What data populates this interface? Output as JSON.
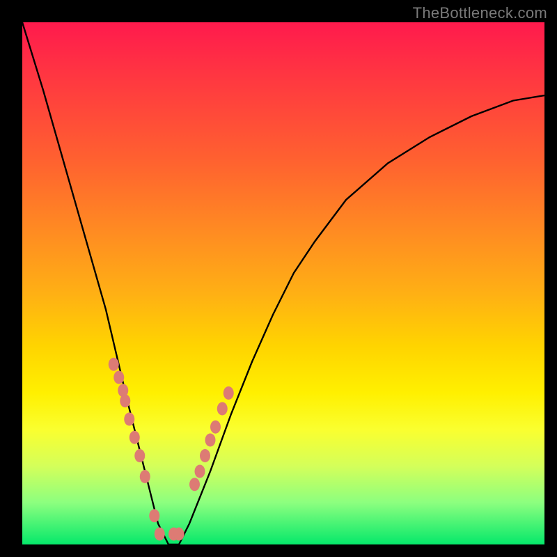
{
  "watermark": "TheBottleneck.com",
  "chart_data": {
    "type": "line",
    "title": "",
    "xlabel": "",
    "ylabel": "",
    "xlim": [
      0,
      1
    ],
    "ylim": [
      0,
      1
    ],
    "series": [
      {
        "name": "bottleneck-curve",
        "x": [
          0.0,
          0.04,
          0.08,
          0.12,
          0.16,
          0.2,
          0.22,
          0.24,
          0.26,
          0.28,
          0.3,
          0.32,
          0.36,
          0.4,
          0.44,
          0.48,
          0.52,
          0.56,
          0.62,
          0.7,
          0.78,
          0.86,
          0.94,
          1.0
        ],
        "values": [
          1.0,
          0.87,
          0.73,
          0.59,
          0.45,
          0.28,
          0.2,
          0.12,
          0.04,
          0.0,
          0.0,
          0.04,
          0.14,
          0.25,
          0.35,
          0.44,
          0.52,
          0.58,
          0.66,
          0.73,
          0.78,
          0.82,
          0.85,
          0.86
        ]
      }
    ],
    "markers": {
      "name": "highlight-dots",
      "x": [
        0.175,
        0.185,
        0.193,
        0.197,
        0.205,
        0.215,
        0.225,
        0.235,
        0.253,
        0.263,
        0.29,
        0.3,
        0.33,
        0.34,
        0.35,
        0.36,
        0.37,
        0.383,
        0.395
      ],
      "values": [
        0.345,
        0.32,
        0.295,
        0.275,
        0.24,
        0.205,
        0.17,
        0.13,
        0.055,
        0.02,
        0.02,
        0.02,
        0.115,
        0.14,
        0.17,
        0.2,
        0.225,
        0.26,
        0.29
      ]
    },
    "colors": {
      "curve": "#000000",
      "marker_fill": "#dd7b74",
      "background_top": "#ff1a4d",
      "background_bottom": "#05e86a"
    }
  }
}
